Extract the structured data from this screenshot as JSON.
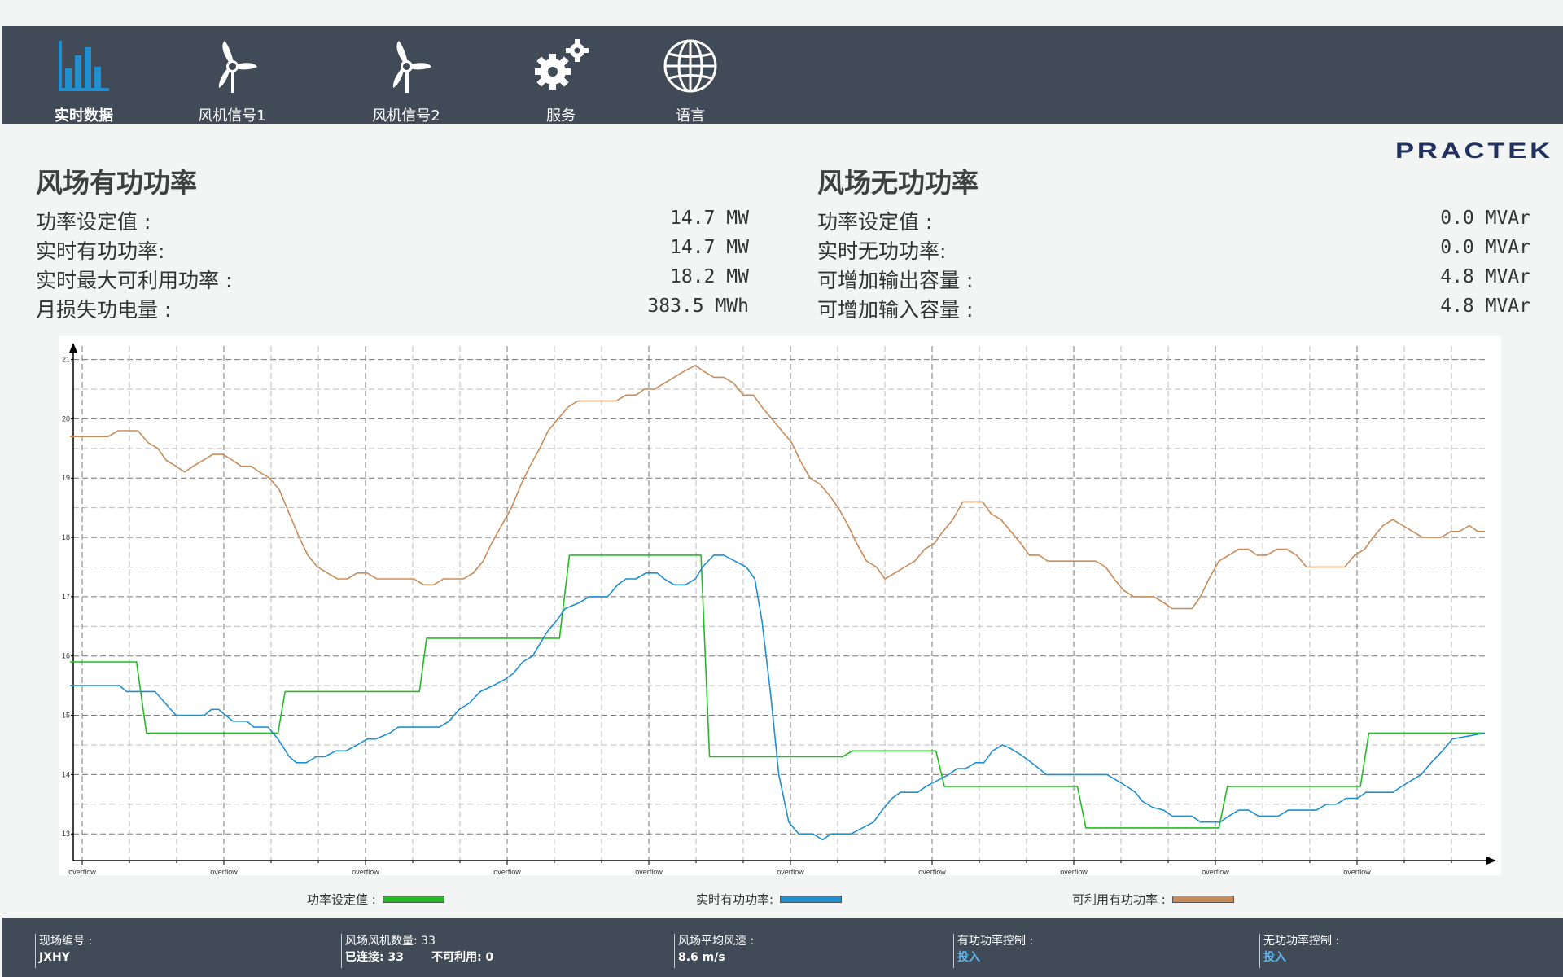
{
  "nav": {
    "items": [
      {
        "label": "实时数据",
        "icon": "bar-chart-icon",
        "active": true
      },
      {
        "label": "风机信号1",
        "icon": "wind-turbine-icon"
      },
      {
        "label": "风机信号2",
        "icon": "wind-turbine-icon"
      },
      {
        "label": "服务",
        "icon": "gears-icon"
      },
      {
        "label": "语言",
        "icon": "globe-icon"
      }
    ]
  },
  "brand": {
    "logo_text": "PRACTEK",
    "color": "#22325f"
  },
  "active_power": {
    "title": "风场有功功率",
    "rows": [
      {
        "label": "功率设定值 :",
        "value": "14.7 MW"
      },
      {
        "label": "实时有功功率:",
        "value": "14.7 MW"
      },
      {
        "label": "实时最大可利用功率 :",
        "value": "18.2 MW"
      },
      {
        "label": "月损失功电量 :",
        "value": "383.5 MWh"
      }
    ]
  },
  "reactive_power": {
    "title": "风场无功功率",
    "rows": [
      {
        "label": "功率设定值 :",
        "value": "0.0 MVAr"
      },
      {
        "label": "实时无功功率:",
        "value": "0.0 MVAr"
      },
      {
        "label": "可增加输出容量 :",
        "value": "4.8 MVAr"
      },
      {
        "label": "可增加输入容量 :",
        "value": "4.8 MVAr"
      }
    ]
  },
  "chart_data": {
    "type": "line",
    "ylim": [
      12.55,
      21.2
    ],
    "yticks": [
      13,
      14,
      15,
      16,
      17,
      18,
      19,
      20,
      21
    ],
    "x_tick_labels": [
      "overflow",
      "overflow",
      "overflow",
      "overflow",
      "overflow",
      "overflow",
      "overflow",
      "overflow",
      "overflow",
      "overflow"
    ],
    "x_range": [
      0,
      100
    ],
    "grid": true,
    "series": [
      {
        "name": "功率设定值",
        "color": "#22bb22",
        "points": [
          [
            0,
            15.9
          ],
          [
            4.7,
            15.9
          ],
          [
            5.4,
            14.7
          ],
          [
            14.7,
            14.7
          ],
          [
            15.2,
            15.4
          ],
          [
            24.7,
            15.4
          ],
          [
            25.2,
            16.3
          ],
          [
            34.6,
            16.3
          ],
          [
            35.3,
            17.7
          ],
          [
            44.6,
            17.7
          ],
          [
            45.2,
            14.3
          ],
          [
            54.6,
            14.3
          ],
          [
            55.3,
            14.4
          ],
          [
            61.2,
            14.4
          ],
          [
            61.8,
            13.8
          ],
          [
            71.2,
            13.8
          ],
          [
            71.8,
            13.1
          ],
          [
            81.2,
            13.1
          ],
          [
            81.8,
            13.8
          ],
          [
            91.2,
            13.8
          ],
          [
            91.8,
            14.7
          ],
          [
            100,
            14.7
          ]
        ]
      },
      {
        "name": "实时有功功率",
        "color": "#1f8fd0",
        "points": [
          [
            0,
            15.5
          ],
          [
            3.5,
            15.5
          ],
          [
            4,
            15.4
          ],
          [
            6,
            15.4
          ],
          [
            7.5,
            15
          ],
          [
            9.5,
            15
          ],
          [
            10,
            15.1
          ],
          [
            10.5,
            15.1
          ],
          [
            11.5,
            14.9
          ],
          [
            12.5,
            14.9
          ],
          [
            13,
            14.8
          ],
          [
            14,
            14.8
          ],
          [
            14.7,
            14.6
          ],
          [
            15.5,
            14.3
          ],
          [
            16,
            14.2
          ],
          [
            16.7,
            14.2
          ],
          [
            17.4,
            14.3
          ],
          [
            18,
            14.3
          ],
          [
            18.8,
            14.4
          ],
          [
            19.5,
            14.4
          ],
          [
            20.3,
            14.5
          ],
          [
            21,
            14.6
          ],
          [
            21.6,
            14.6
          ],
          [
            22.6,
            14.7
          ],
          [
            23.2,
            14.8
          ],
          [
            26.1,
            14.8
          ],
          [
            26.8,
            14.9
          ],
          [
            27.5,
            15.1
          ],
          [
            28.2,
            15.2
          ],
          [
            29,
            15.4
          ],
          [
            29.9,
            15.5
          ],
          [
            30.7,
            15.6
          ],
          [
            31.3,
            15.7
          ],
          [
            32,
            15.9
          ],
          [
            32.7,
            16
          ],
          [
            33.2,
            16.2
          ],
          [
            33.7,
            16.4
          ],
          [
            34.4,
            16.6
          ],
          [
            35,
            16.8
          ],
          [
            36,
            16.9
          ],
          [
            36.7,
            17
          ],
          [
            38,
            17
          ],
          [
            38.7,
            17.2
          ],
          [
            39.3,
            17.3
          ],
          [
            40,
            17.3
          ],
          [
            40.7,
            17.4
          ],
          [
            41.5,
            17.4
          ],
          [
            42,
            17.3
          ],
          [
            42.7,
            17.2
          ],
          [
            43.5,
            17.2
          ],
          [
            44.2,
            17.3
          ],
          [
            44.7,
            17.5
          ],
          [
            45.5,
            17.7
          ],
          [
            46.2,
            17.7
          ],
          [
            47,
            17.6
          ],
          [
            47.8,
            17.5
          ],
          [
            48.4,
            17.3
          ],
          [
            48.9,
            16.6
          ],
          [
            49.5,
            15.4
          ],
          [
            50.1,
            14
          ],
          [
            50.8,
            13.2
          ],
          [
            51.5,
            13
          ],
          [
            52.5,
            13
          ],
          [
            53.2,
            12.9
          ],
          [
            53.8,
            13
          ],
          [
            55.2,
            13
          ],
          [
            56,
            13.1
          ],
          [
            56.8,
            13.2
          ],
          [
            57.4,
            13.4
          ],
          [
            58.1,
            13.6
          ],
          [
            58.7,
            13.7
          ],
          [
            59.9,
            13.7
          ],
          [
            60.5,
            13.8
          ],
          [
            61.3,
            13.9
          ],
          [
            62.1,
            14
          ],
          [
            62.7,
            14.1
          ],
          [
            63.3,
            14.1
          ],
          [
            64,
            14.2
          ],
          [
            64.6,
            14.2
          ],
          [
            65.2,
            14.4
          ],
          [
            65.9,
            14.5
          ],
          [
            66.4,
            14.45
          ],
          [
            67.1,
            14.35
          ],
          [
            67.7,
            14.25
          ],
          [
            68.5,
            14.1
          ],
          [
            69,
            14
          ],
          [
            73.3,
            14
          ],
          [
            74,
            13.9
          ],
          [
            74.7,
            13.8
          ],
          [
            75.3,
            13.7
          ],
          [
            75.8,
            13.55
          ],
          [
            76.5,
            13.45
          ],
          [
            77.3,
            13.4
          ],
          [
            77.9,
            13.3
          ],
          [
            79.3,
            13.3
          ],
          [
            79.9,
            13.2
          ],
          [
            81.3,
            13.2
          ],
          [
            81.9,
            13.3
          ],
          [
            82.6,
            13.4
          ],
          [
            83.3,
            13.4
          ],
          [
            84,
            13.3
          ],
          [
            85.4,
            13.3
          ],
          [
            86.1,
            13.4
          ],
          [
            88.1,
            13.4
          ],
          [
            88.8,
            13.5
          ],
          [
            89.5,
            13.5
          ],
          [
            90.2,
            13.6
          ],
          [
            91,
            13.6
          ],
          [
            91.6,
            13.7
          ],
          [
            93.5,
            13.7
          ],
          [
            94.1,
            13.8
          ],
          [
            94.8,
            13.9
          ],
          [
            95.5,
            14
          ],
          [
            96.2,
            14.2
          ],
          [
            97,
            14.4
          ],
          [
            97.7,
            14.6
          ],
          [
            100,
            14.7
          ]
        ]
      },
      {
        "name": "可利用有功功率",
        "color": "#c88c5a",
        "points": [
          [
            0,
            19.7
          ],
          [
            2.7,
            19.7
          ],
          [
            3.4,
            19.8
          ],
          [
            4.8,
            19.8
          ],
          [
            5.5,
            19.6
          ],
          [
            6.2,
            19.5
          ],
          [
            6.8,
            19.3
          ],
          [
            7.5,
            19.2
          ],
          [
            8.1,
            19.1
          ],
          [
            8.7,
            19.2
          ],
          [
            9.4,
            19.3
          ],
          [
            10.1,
            19.4
          ],
          [
            10.8,
            19.4
          ],
          [
            11.5,
            19.3
          ],
          [
            12.1,
            19.2
          ],
          [
            12.8,
            19.2
          ],
          [
            13.4,
            19.1
          ],
          [
            14.1,
            19
          ],
          [
            14.8,
            18.8
          ],
          [
            15.5,
            18.4
          ],
          [
            16.2,
            18
          ],
          [
            16.8,
            17.7
          ],
          [
            17.5,
            17.5
          ],
          [
            18.2,
            17.4
          ],
          [
            18.9,
            17.3
          ],
          [
            19.6,
            17.3
          ],
          [
            20.3,
            17.4
          ],
          [
            21,
            17.4
          ],
          [
            21.7,
            17.3
          ],
          [
            24.3,
            17.3
          ],
          [
            25,
            17.2
          ],
          [
            25.7,
            17.2
          ],
          [
            26.4,
            17.3
          ],
          [
            27.8,
            17.3
          ],
          [
            28.5,
            17.4
          ],
          [
            29.2,
            17.6
          ],
          [
            29.8,
            17.9
          ],
          [
            30.5,
            18.2
          ],
          [
            31.2,
            18.5
          ],
          [
            31.9,
            18.9
          ],
          [
            32.5,
            19.2
          ],
          [
            33.2,
            19.5
          ],
          [
            33.8,
            19.8
          ],
          [
            34.5,
            20
          ],
          [
            35.2,
            20.2
          ],
          [
            35.9,
            20.3
          ],
          [
            38.6,
            20.3
          ],
          [
            39.3,
            20.4
          ],
          [
            40,
            20.4
          ],
          [
            40.6,
            20.5
          ],
          [
            41.3,
            20.5
          ],
          [
            42,
            20.6
          ],
          [
            42.7,
            20.7
          ],
          [
            43.4,
            20.8
          ],
          [
            44.2,
            20.9
          ],
          [
            44.8,
            20.8
          ],
          [
            45.5,
            20.7
          ],
          [
            46.2,
            20.7
          ],
          [
            46.9,
            20.6
          ],
          [
            47.6,
            20.4
          ],
          [
            48.3,
            20.4
          ],
          [
            48.9,
            20.2
          ],
          [
            49.6,
            20
          ],
          [
            50.3,
            19.8
          ],
          [
            51,
            19.6
          ],
          [
            51.6,
            19.3
          ],
          [
            52.3,
            19
          ],
          [
            53,
            18.9
          ],
          [
            53.7,
            18.7
          ],
          [
            54.3,
            18.5
          ],
          [
            55,
            18.2
          ],
          [
            55.6,
            17.9
          ],
          [
            56.3,
            17.6
          ],
          [
            57,
            17.5
          ],
          [
            57.6,
            17.3
          ],
          [
            58.3,
            17.4
          ],
          [
            59,
            17.5
          ],
          [
            59.7,
            17.6
          ],
          [
            60.4,
            17.8
          ],
          [
            61.1,
            17.9
          ],
          [
            61.7,
            18.1
          ],
          [
            62.4,
            18.3
          ],
          [
            63.1,
            18.6
          ],
          [
            64.5,
            18.6
          ],
          [
            65.1,
            18.4
          ],
          [
            65.8,
            18.3
          ],
          [
            66.5,
            18.1
          ],
          [
            67.2,
            17.9
          ],
          [
            67.8,
            17.7
          ],
          [
            68.5,
            17.7
          ],
          [
            69.1,
            17.6
          ],
          [
            72.5,
            17.6
          ],
          [
            73.2,
            17.5
          ],
          [
            73.8,
            17.3
          ],
          [
            74.5,
            17.1
          ],
          [
            75.2,
            17
          ],
          [
            76.6,
            17
          ],
          [
            77.3,
            16.9
          ],
          [
            77.9,
            16.8
          ],
          [
            79.3,
            16.8
          ],
          [
            79.9,
            17
          ],
          [
            80.5,
            17.3
          ],
          [
            81.2,
            17.6
          ],
          [
            81.9,
            17.7
          ],
          [
            82.6,
            17.8
          ],
          [
            83.3,
            17.8
          ],
          [
            83.9,
            17.7
          ],
          [
            84.6,
            17.7
          ],
          [
            85.3,
            17.8
          ],
          [
            86,
            17.8
          ],
          [
            86.7,
            17.7
          ],
          [
            87.4,
            17.5
          ],
          [
            90.1,
            17.5
          ],
          [
            90.8,
            17.7
          ],
          [
            91.5,
            17.8
          ],
          [
            92.1,
            18
          ],
          [
            92.8,
            18.2
          ],
          [
            93.5,
            18.3
          ],
          [
            94.2,
            18.2
          ],
          [
            94.9,
            18.1
          ],
          [
            95.6,
            18
          ],
          [
            96.9,
            18
          ],
          [
            97.6,
            18.1
          ],
          [
            98.2,
            18.1
          ],
          [
            98.9,
            18.2
          ],
          [
            99.5,
            18.1
          ],
          [
            100,
            18.1
          ]
        ]
      }
    ]
  },
  "legend": [
    {
      "label": "功率设定值 :",
      "color": "#22bb22"
    },
    {
      "label": "实时有功功率:",
      "color": "#1f8fd0"
    },
    {
      "label": "可利用有功功率 :",
      "color": "#c88c5a"
    }
  ],
  "footer": {
    "site": {
      "label": "现场编号 :",
      "value": "JXHY"
    },
    "turbines": {
      "label": "风场风机数量: 33",
      "value": "已连接: 33       不可利用: 0"
    },
    "wind": {
      "label": "风场平均风速 :",
      "value": "8.6 m/s"
    },
    "active_ctrl": {
      "label": "有功功率控制 :",
      "value": "投入"
    },
    "reactive_ctrl": {
      "label": "无功功率控制 :",
      "value": "投入"
    }
  }
}
